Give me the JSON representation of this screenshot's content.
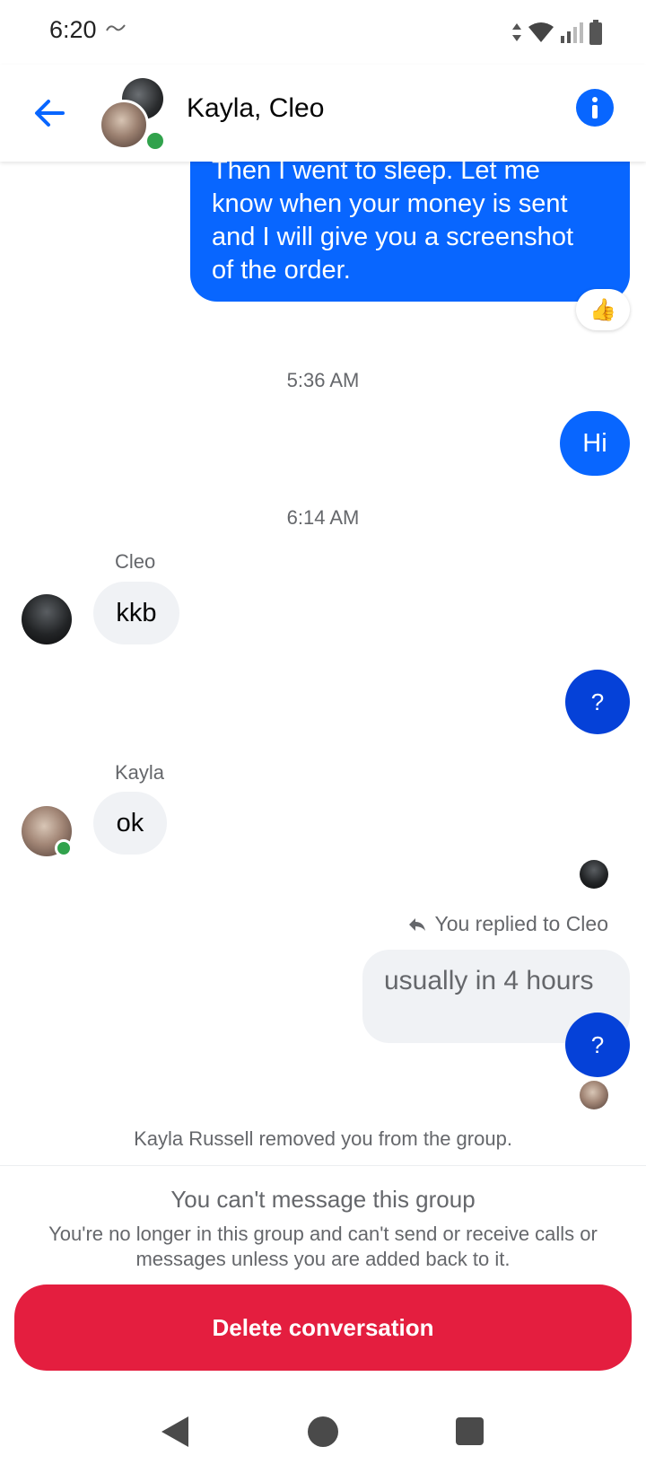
{
  "status_bar": {
    "time": "6:20",
    "carrier_icon": "carrier-logo"
  },
  "header": {
    "title": "Kayla, Cleo",
    "back_icon": "back-arrow-icon",
    "info_icon": "info-icon"
  },
  "messages": {
    "m1_text": "Then I went to sleep. Let me know when your money is sent and I will give you a screenshot of the order.",
    "m1_line1": "Then I went to sleep. Let me",
    "m1_line2": "know when your money is sent",
    "m1_line3": "and I will give you a screenshot",
    "m1_line4": "of the order.",
    "m1_reaction": "👍",
    "ts1": "5:36 AM",
    "m2_text": "Hi",
    "ts2": "6:14 AM",
    "cleo_name": "Cleo",
    "cleo_msg": "kkb",
    "q1": "?",
    "kayla_name": "Kayla",
    "kayla_msg": "ok",
    "reply_label": "You replied to Cleo",
    "reply_text": "usually in 4 hours",
    "q2": "?",
    "system_text": "Kayla Russell removed you from the group."
  },
  "footer": {
    "title": "You can't message this group",
    "body": "You're no longer in this group and can't send or receive calls or messages unless you are added back to it.",
    "delete_label": "Delete conversation"
  },
  "colors": {
    "accent": "#0866ff",
    "danger": "#e41e3f",
    "online": "#31a24c"
  }
}
